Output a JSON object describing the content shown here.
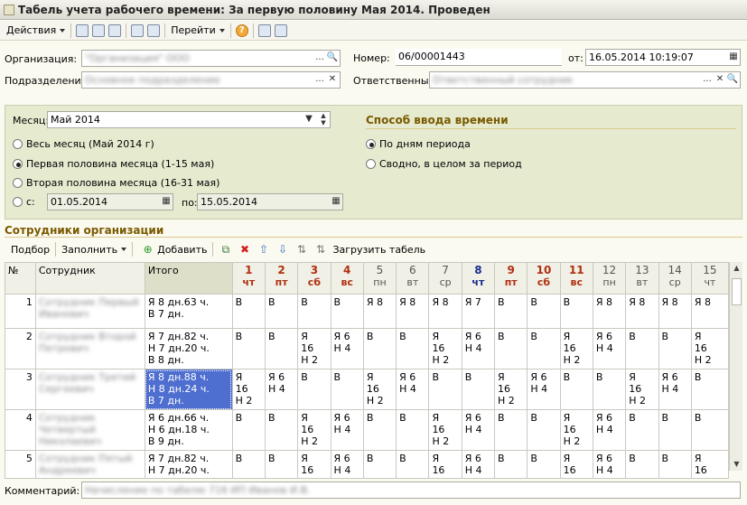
{
  "window": {
    "title": "Табель учета рабочего времени: За первую половину Мая 2014. Проведен"
  },
  "toolbar": {
    "actions": "Действия",
    "goto": "Перейти",
    "help": "?"
  },
  "form": {
    "org_label": "Организация:",
    "org_value": "\"Организация\" ООО",
    "dept_label": "Подразделение:",
    "dept_value": "Основное подразделение",
    "num_label": "Номер:",
    "num_value": "06/00001443",
    "from_label": "от:",
    "date_value": "16.05.2014 10:19:07",
    "resp_label": "Ответственный:",
    "resp_value": "Ответственный сотрудник"
  },
  "panel": {
    "month_label": "Месяц:",
    "month_value": "Май 2014",
    "options": [
      "Весь месяц (Май 2014 г)",
      "Первая половина месяца (1-15 мая)",
      "Вторая половина месяца (16-31 мая)"
    ],
    "custom_from_label": "с:",
    "custom_from": "01.05.2014",
    "custom_to_label": "по:",
    "custom_to": "15.05.2014",
    "input_title": "Способ ввода времени",
    "input_opt1": "По дням периода",
    "input_opt2": "Сводно, в целом за период"
  },
  "section": {
    "title": "Сотрудники организации"
  },
  "gridtoolbar": {
    "pick": "Подбор",
    "fill": "Заполнить",
    "add": "Добавить",
    "load": "Загрузить табель"
  },
  "table": {
    "h_num": "№",
    "h_emp": "Сотрудник",
    "h_total": "Итого",
    "days": [
      {
        "d": "1",
        "w": "чт"
      },
      {
        "d": "2",
        "w": "пт"
      },
      {
        "d": "3",
        "w": "сб"
      },
      {
        "d": "4",
        "w": "вс"
      },
      {
        "d": "5",
        "w": "пн"
      },
      {
        "d": "6",
        "w": "вт"
      },
      {
        "d": "7",
        "w": "ср"
      },
      {
        "d": "8",
        "w": "чт"
      },
      {
        "d": "9",
        "w": "пт"
      },
      {
        "d": "10",
        "w": "сб"
      },
      {
        "d": "11",
        "w": "вс"
      },
      {
        "d": "12",
        "w": "пн"
      },
      {
        "d": "13",
        "w": "вт"
      },
      {
        "d": "14",
        "w": "ср"
      },
      {
        "d": "15",
        "w": "чт"
      }
    ],
    "rows": [
      {
        "n": "1",
        "emp": [
          "Сотрудник Первый",
          "Иванович"
        ],
        "total": [
          "Я 8 дн.63 ч.",
          "В 7 дн."
        ],
        "cells": [
          [
            "В"
          ],
          [
            "В"
          ],
          [
            "В"
          ],
          [
            "В"
          ],
          [
            "Я 8"
          ],
          [
            "Я 8"
          ],
          [
            "Я 8"
          ],
          [
            "Я 7"
          ],
          [
            "В"
          ],
          [
            "В"
          ],
          [
            "В"
          ],
          [
            "Я 8"
          ],
          [
            "Я 8"
          ],
          [
            "Я 8"
          ],
          [
            "Я 8"
          ]
        ]
      },
      {
        "n": "2",
        "emp": [
          "Сотрудник Второй",
          "Петрович"
        ],
        "total": [
          "Я 7 дн.82 ч.",
          "Н 7 дн.20 ч.",
          "В 8 дн."
        ],
        "cells": [
          [
            "В"
          ],
          [
            "В"
          ],
          [
            "Я",
            "16",
            "Н 2"
          ],
          [
            "Я 6",
            "Н 4"
          ],
          [
            "В"
          ],
          [
            "В"
          ],
          [
            "Я",
            "16",
            "Н 2"
          ],
          [
            "Я 6",
            "Н 4"
          ],
          [
            "В"
          ],
          [
            "В"
          ],
          [
            "Я",
            "16",
            "Н 2"
          ],
          [
            "Я 6",
            "Н 4"
          ],
          [
            "В"
          ],
          [
            "В"
          ],
          [
            "Я",
            "16",
            "Н 2"
          ]
        ]
      },
      {
        "n": "3",
        "emp": [
          "Сотрудник Третий",
          "Сергеевич"
        ],
        "total": [
          "Я 8 дн.88 ч.",
          "Н 8 дн.24 ч.",
          "В 7 дн."
        ],
        "cells": [
          [
            "Я",
            "16",
            "Н 2"
          ],
          [
            "Я 6",
            "Н 4"
          ],
          [
            "В"
          ],
          [
            "В"
          ],
          [
            "Я",
            "16",
            "Н 2"
          ],
          [
            "Я 6",
            "Н 4"
          ],
          [
            "В"
          ],
          [
            "В"
          ],
          [
            "Я",
            "16",
            "Н 2"
          ],
          [
            "Я 6",
            "Н 4"
          ],
          [
            "В"
          ],
          [
            "В"
          ],
          [
            "Я",
            "16",
            "Н 2"
          ],
          [
            "Я 6",
            "Н 4"
          ],
          [
            "В"
          ]
        ]
      },
      {
        "n": "4",
        "emp": [
          "Сотрудник",
          "Четвертый",
          "Николаевич"
        ],
        "total": [
          "Я 6 дн.66 ч.",
          "Н 6 дн.18 ч.",
          "В 9 дн."
        ],
        "cells": [
          [
            "В"
          ],
          [
            "В"
          ],
          [
            "Я",
            "16",
            "Н 2"
          ],
          [
            "Я 6",
            "Н 4"
          ],
          [
            "В"
          ],
          [
            "В"
          ],
          [
            "Я",
            "16",
            "Н 2"
          ],
          [
            "Я 6",
            "Н 4"
          ],
          [
            "В"
          ],
          [
            "В"
          ],
          [
            "Я",
            "16",
            "Н 2"
          ],
          [
            "Я 6",
            "Н 4"
          ],
          [
            "В"
          ],
          [
            "В"
          ],
          [
            "В"
          ]
        ]
      },
      {
        "n": "5",
        "emp": [
          "Сотрудник Пятый",
          "Андреевич"
        ],
        "total": [
          "Я 7 дн.82 ч.",
          "Н 7 дн.20 ч."
        ],
        "cells": [
          [
            "В"
          ],
          [
            "В"
          ],
          [
            "Я",
            "16"
          ],
          [
            "Я 6",
            "Н 4"
          ],
          [
            "В"
          ],
          [
            "В"
          ],
          [
            "Я",
            "16"
          ],
          [
            "Я 6",
            "Н 4"
          ],
          [
            "В"
          ],
          [
            "В"
          ],
          [
            "Я",
            "16"
          ],
          [
            "Я 6",
            "Н 4"
          ],
          [
            "В"
          ],
          [
            "В"
          ],
          [
            "Я",
            "16"
          ]
        ]
      }
    ]
  },
  "comment": {
    "label": "Комментарий:",
    "value": "Начисление по табелю 716 ИП Иванов И.В."
  }
}
